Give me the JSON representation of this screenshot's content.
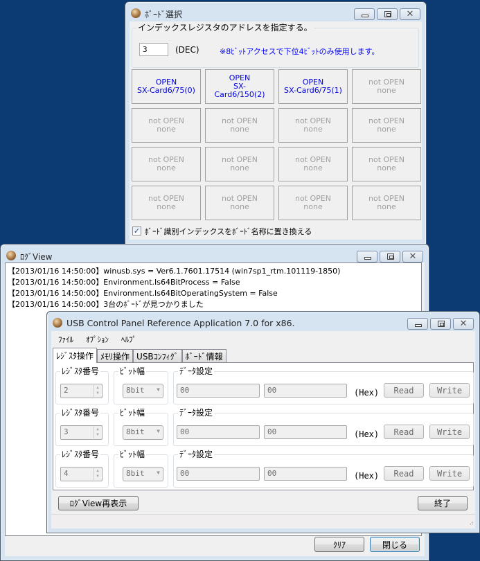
{
  "board_window": {
    "title": "ﾎﾞｰﾄﾞ選択",
    "index_group_label": "インデックスレジスタのアドレスを指定する。",
    "index_value": "3",
    "index_unit": "(DEC)",
    "note": "※8ﾋﾞｯﾄアクセスで下位4ﾋﾞｯﾄのみ使用します。",
    "boards": [
      {
        "status": "OPEN",
        "name": "SX-Card6/75(0)",
        "open": true
      },
      {
        "status": "OPEN",
        "name": "SX-Card6/150(2)",
        "open": true
      },
      {
        "status": "OPEN",
        "name": "SX-Card6/75(1)",
        "open": true
      },
      {
        "status": "not OPEN",
        "name": "none",
        "open": false
      },
      {
        "status": "not OPEN",
        "name": "none",
        "open": false
      },
      {
        "status": "not OPEN",
        "name": "none",
        "open": false
      },
      {
        "status": "not OPEN",
        "name": "none",
        "open": false
      },
      {
        "status": "not OPEN",
        "name": "none",
        "open": false
      },
      {
        "status": "not OPEN",
        "name": "none",
        "open": false
      },
      {
        "status": "not OPEN",
        "name": "none",
        "open": false
      },
      {
        "status": "not OPEN",
        "name": "none",
        "open": false
      },
      {
        "status": "not OPEN",
        "name": "none",
        "open": false
      },
      {
        "status": "not OPEN",
        "name": "none",
        "open": false
      },
      {
        "status": "not OPEN",
        "name": "none",
        "open": false
      },
      {
        "status": "not OPEN",
        "name": "none",
        "open": false
      },
      {
        "status": "not OPEN",
        "name": "none",
        "open": false
      }
    ],
    "replace_checkbox_label": "ﾎﾞｰﾄﾞ識別インデックスをﾎﾞｰﾄﾞ名称に置き換える",
    "replace_checked": true
  },
  "log_window": {
    "title": "ﾛｸﾞView",
    "lines": [
      "【2013/01/16 14:50:00】winusb.sys = Ver6.1.7601.17514 (win7sp1_rtm.101119-1850)",
      "【2013/01/16 14:50:00】Environment.Is64BitProcess = False",
      "【2013/01/16 14:50:00】Environment.Is64BitOperatingSystem = False",
      "【2013/01/16 14:50:00】3台のﾎﾞｰﾄﾞが見つかりました"
    ],
    "clear_label": "ｸﾘｱ",
    "close_label": "閉じる"
  },
  "app_window": {
    "title": "USB Control Panel Reference Application 7.0 for x86.",
    "menu": [
      "ﾌｧｲﾙ",
      "ｵﾌﾟｼｮﾝ",
      "ﾍﾙﾌﾟ"
    ],
    "tabs": [
      "ﾚｼﾞｽﾀ操作",
      "ﾒﾓﾘ操作",
      "USBｺﾝﾌｨｸﾞ",
      "ﾎﾞｰﾄﾞ情報"
    ],
    "active_tab": 0,
    "register_rows": [
      {
        "reg_label": "ﾚｼﾞｽﾀ番号",
        "reg_value": "2",
        "width_label": "ﾋﾞｯﾄ幅",
        "width_value": "8bit",
        "data_label": "ﾃﾞｰﾀ設定",
        "data1": "00",
        "data2": "00",
        "unit": "(Hex)",
        "read": "Read",
        "write": "Write"
      },
      {
        "reg_label": "ﾚｼﾞｽﾀ番号",
        "reg_value": "3",
        "width_label": "ﾋﾞｯﾄ幅",
        "width_value": "8bit",
        "data_label": "ﾃﾞｰﾀ設定",
        "data1": "00",
        "data2": "00",
        "unit": "(Hex)",
        "read": "Read",
        "write": "Write"
      },
      {
        "reg_label": "ﾚｼﾞｽﾀ番号",
        "reg_value": "4",
        "width_label": "ﾋﾞｯﾄ幅",
        "width_value": "8bit",
        "data_label": "ﾃﾞｰﾀ設定",
        "data1": "00",
        "data2": "00",
        "unit": "(Hex)",
        "read": "Read",
        "write": "Write"
      }
    ],
    "log_reshow_label": "ﾛｸﾞView再表示",
    "exit_label": "終了"
  }
}
